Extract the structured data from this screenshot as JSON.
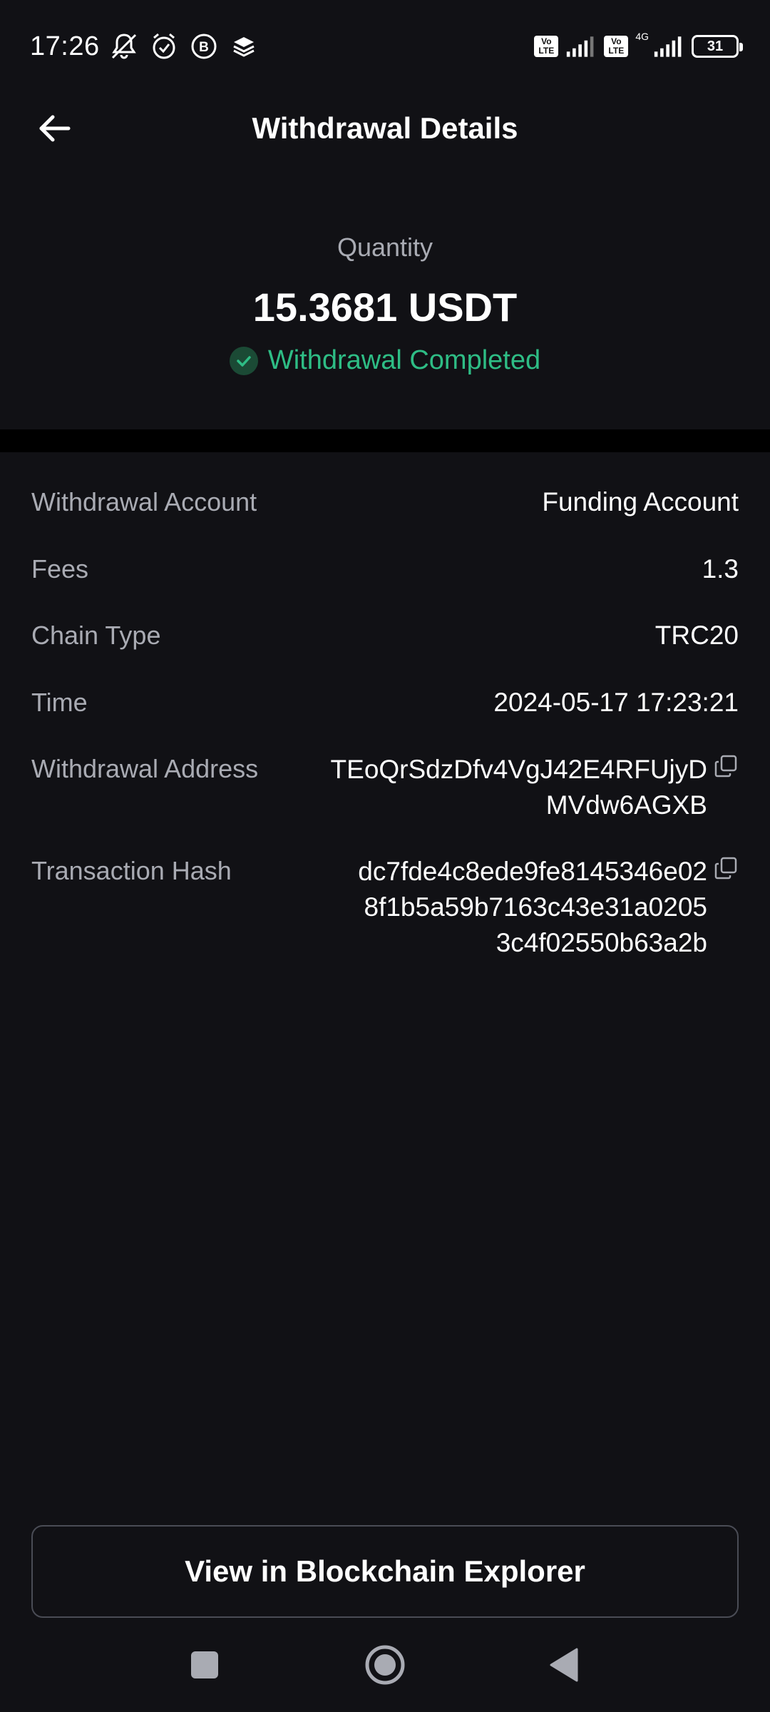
{
  "status_bar": {
    "time": "17:26",
    "left_icons": [
      "notifications-muted-icon",
      "alarm-icon",
      "b-app-icon",
      "layers-icon"
    ],
    "volte_label": "Vo\nLTE",
    "network_label": "4G",
    "battery_level": "31"
  },
  "header": {
    "title": "Withdrawal Details",
    "back_icon": "arrow-left-icon"
  },
  "summary": {
    "quantity_label": "Quantity",
    "quantity_value": "15.3681 USDT",
    "status_text": "Withdrawal Completed",
    "status_color": "#2ebd85"
  },
  "details": {
    "account": {
      "label": "Withdrawal Account",
      "value": "Funding Account"
    },
    "fees": {
      "label": "Fees",
      "value": "1.3"
    },
    "chain": {
      "label": "Chain Type",
      "value": "TRC20"
    },
    "time": {
      "label": "Time",
      "value": "2024-05-17 17:23:21"
    },
    "address": {
      "label": "Withdrawal Address",
      "line1": "TEoQrSdzDfv4VgJ42E4RFUjyD",
      "line2": "MVdw6AGXB"
    },
    "hash": {
      "label": "Transaction Hash",
      "line1": "dc7fde4c8ede9fe8145346e02",
      "line2": "8f1b5a59b7163c43e31a0205",
      "line3": "3c4f02550b63a2b"
    }
  },
  "actions": {
    "explorer_label": "View in Blockchain Explorer"
  },
  "nav": {
    "icons": [
      "recents-square-icon",
      "home-circle-icon",
      "back-triangle-icon"
    ]
  }
}
